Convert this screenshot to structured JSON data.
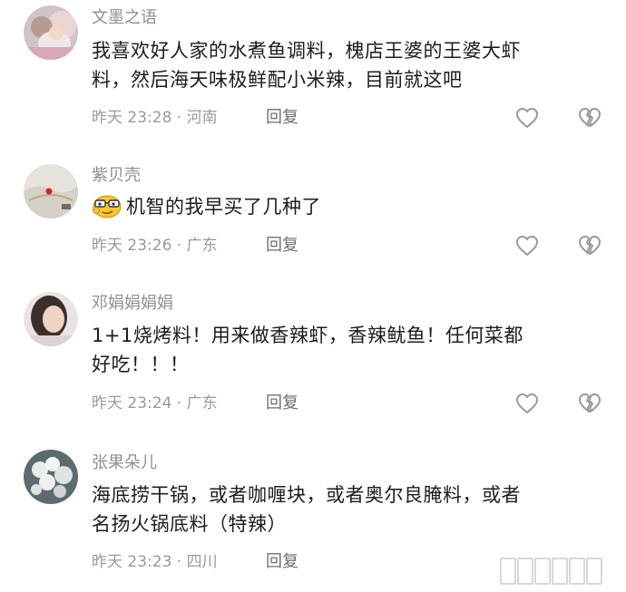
{
  "comments": [
    {
      "username": "文墨之语",
      "lines": [
        "我喜欢好人家的水煮鱼调料，槐店王婆的王婆大虾",
        "料，然后海天味极鲜配小米辣，目前就这吧"
      ],
      "time": "昨天 23:28 · 河南",
      "reply_label": "回复",
      "avatar_icon": "avatar-child-photo",
      "has_emoji": false
    },
    {
      "username": "紫贝壳",
      "lines": [
        "机智的我早买了几种了"
      ],
      "time": "昨天 23:26 · 广东",
      "reply_label": "回复",
      "avatar_icon": "avatar-beach-heart",
      "has_emoji": true,
      "emoji_icon": "smart-face-emoji"
    },
    {
      "username": "邓娟娟娟娟",
      "lines": [
        "1+1烧烤料！用来做香辣虾，香辣鱿鱼！任何菜都",
        "好吃！！！"
      ],
      "time": "昨天 23:24 · 广东",
      "reply_label": "回复",
      "avatar_icon": "avatar-woman-photo",
      "has_emoji": false
    },
    {
      "username": "张果朵儿",
      "lines": [
        "海底捞干锅，或者咖喱块，或者奥尔良腌料，或者",
        "名扬火锅底料（特辣）"
      ],
      "time": "昨天 23:23 · 四川",
      "reply_label": "回复",
      "avatar_icon": "avatar-flowers-photo",
      "has_emoji": false
    }
  ],
  "icons": {
    "like": "heart-outline-icon",
    "dislike": "broken-heart-icon"
  },
  "colors": {
    "username": "#8f8f8f",
    "text": "#1c1c1c",
    "meta": "#9a9a9a",
    "icon": "#9a9a9a"
  }
}
